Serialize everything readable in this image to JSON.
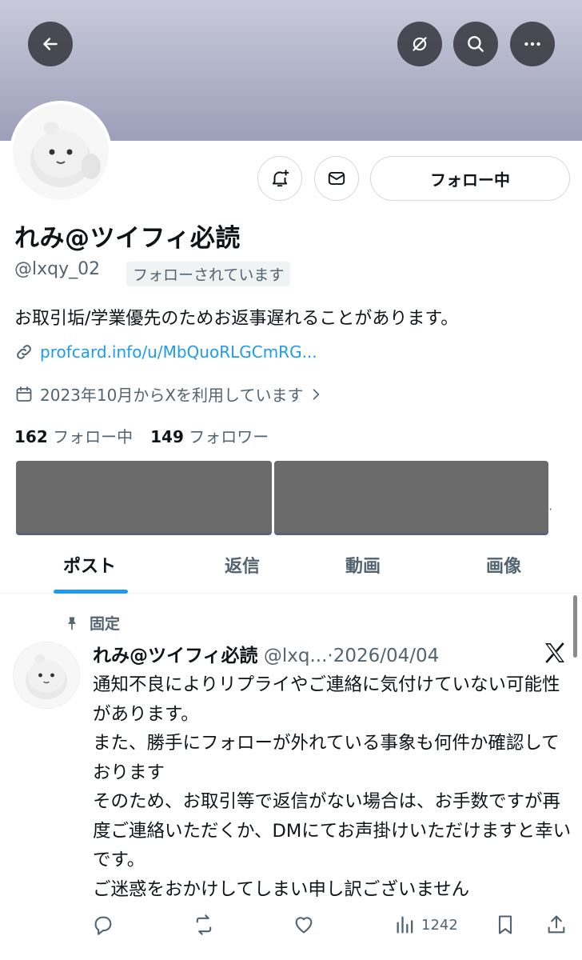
{
  "header": {
    "back_icon": "arrow-left-icon",
    "grok_icon": "grok-icon",
    "search_icon": "search-icon",
    "more_icon": "more-horizontal-icon"
  },
  "profile": {
    "display_name": "れみ@ツイフィ必読",
    "handle": "@lxqy_02",
    "follows_you": "フォローされています",
    "bio": "お取引垢/学業優先のためお返事遅れることがあります。",
    "link": "profcard.info/u/MbQuoRLGCmRG...",
    "joined": "2023年10月からXを利用しています",
    "following_count": "162",
    "following_label": "フォロー中",
    "followers_count": "149",
    "followers_label": "フォロワー",
    "follow_button": "フォロー中"
  },
  "tabs": [
    {
      "label": "ポスト",
      "active": true
    },
    {
      "label": "返信",
      "active": false
    },
    {
      "label": "動画",
      "active": false
    },
    {
      "label": "画像",
      "active": false
    }
  ],
  "post": {
    "pinned_label": "固定",
    "author_name": "れみ@ツイフィ必読",
    "author_handle": "@lxq...",
    "date": "·2026/04/04",
    "text": "通知不良によりリプライやご連絡に気付けていない可能性があります。\nまた、勝手にフォローが外れている事象も何件か確認しております\nそのため、お取引等で返信がない場合は、お手数ですが再度ご連絡いただくか、DMにてお声掛けいただけますと幸いです。\nご迷惑をおかけしてしまい申し訳ございません",
    "views": "1242"
  },
  "colors": {
    "accent": "#1d9bf0",
    "secondary_text": "#536471",
    "banner": "#a6a8c2"
  }
}
